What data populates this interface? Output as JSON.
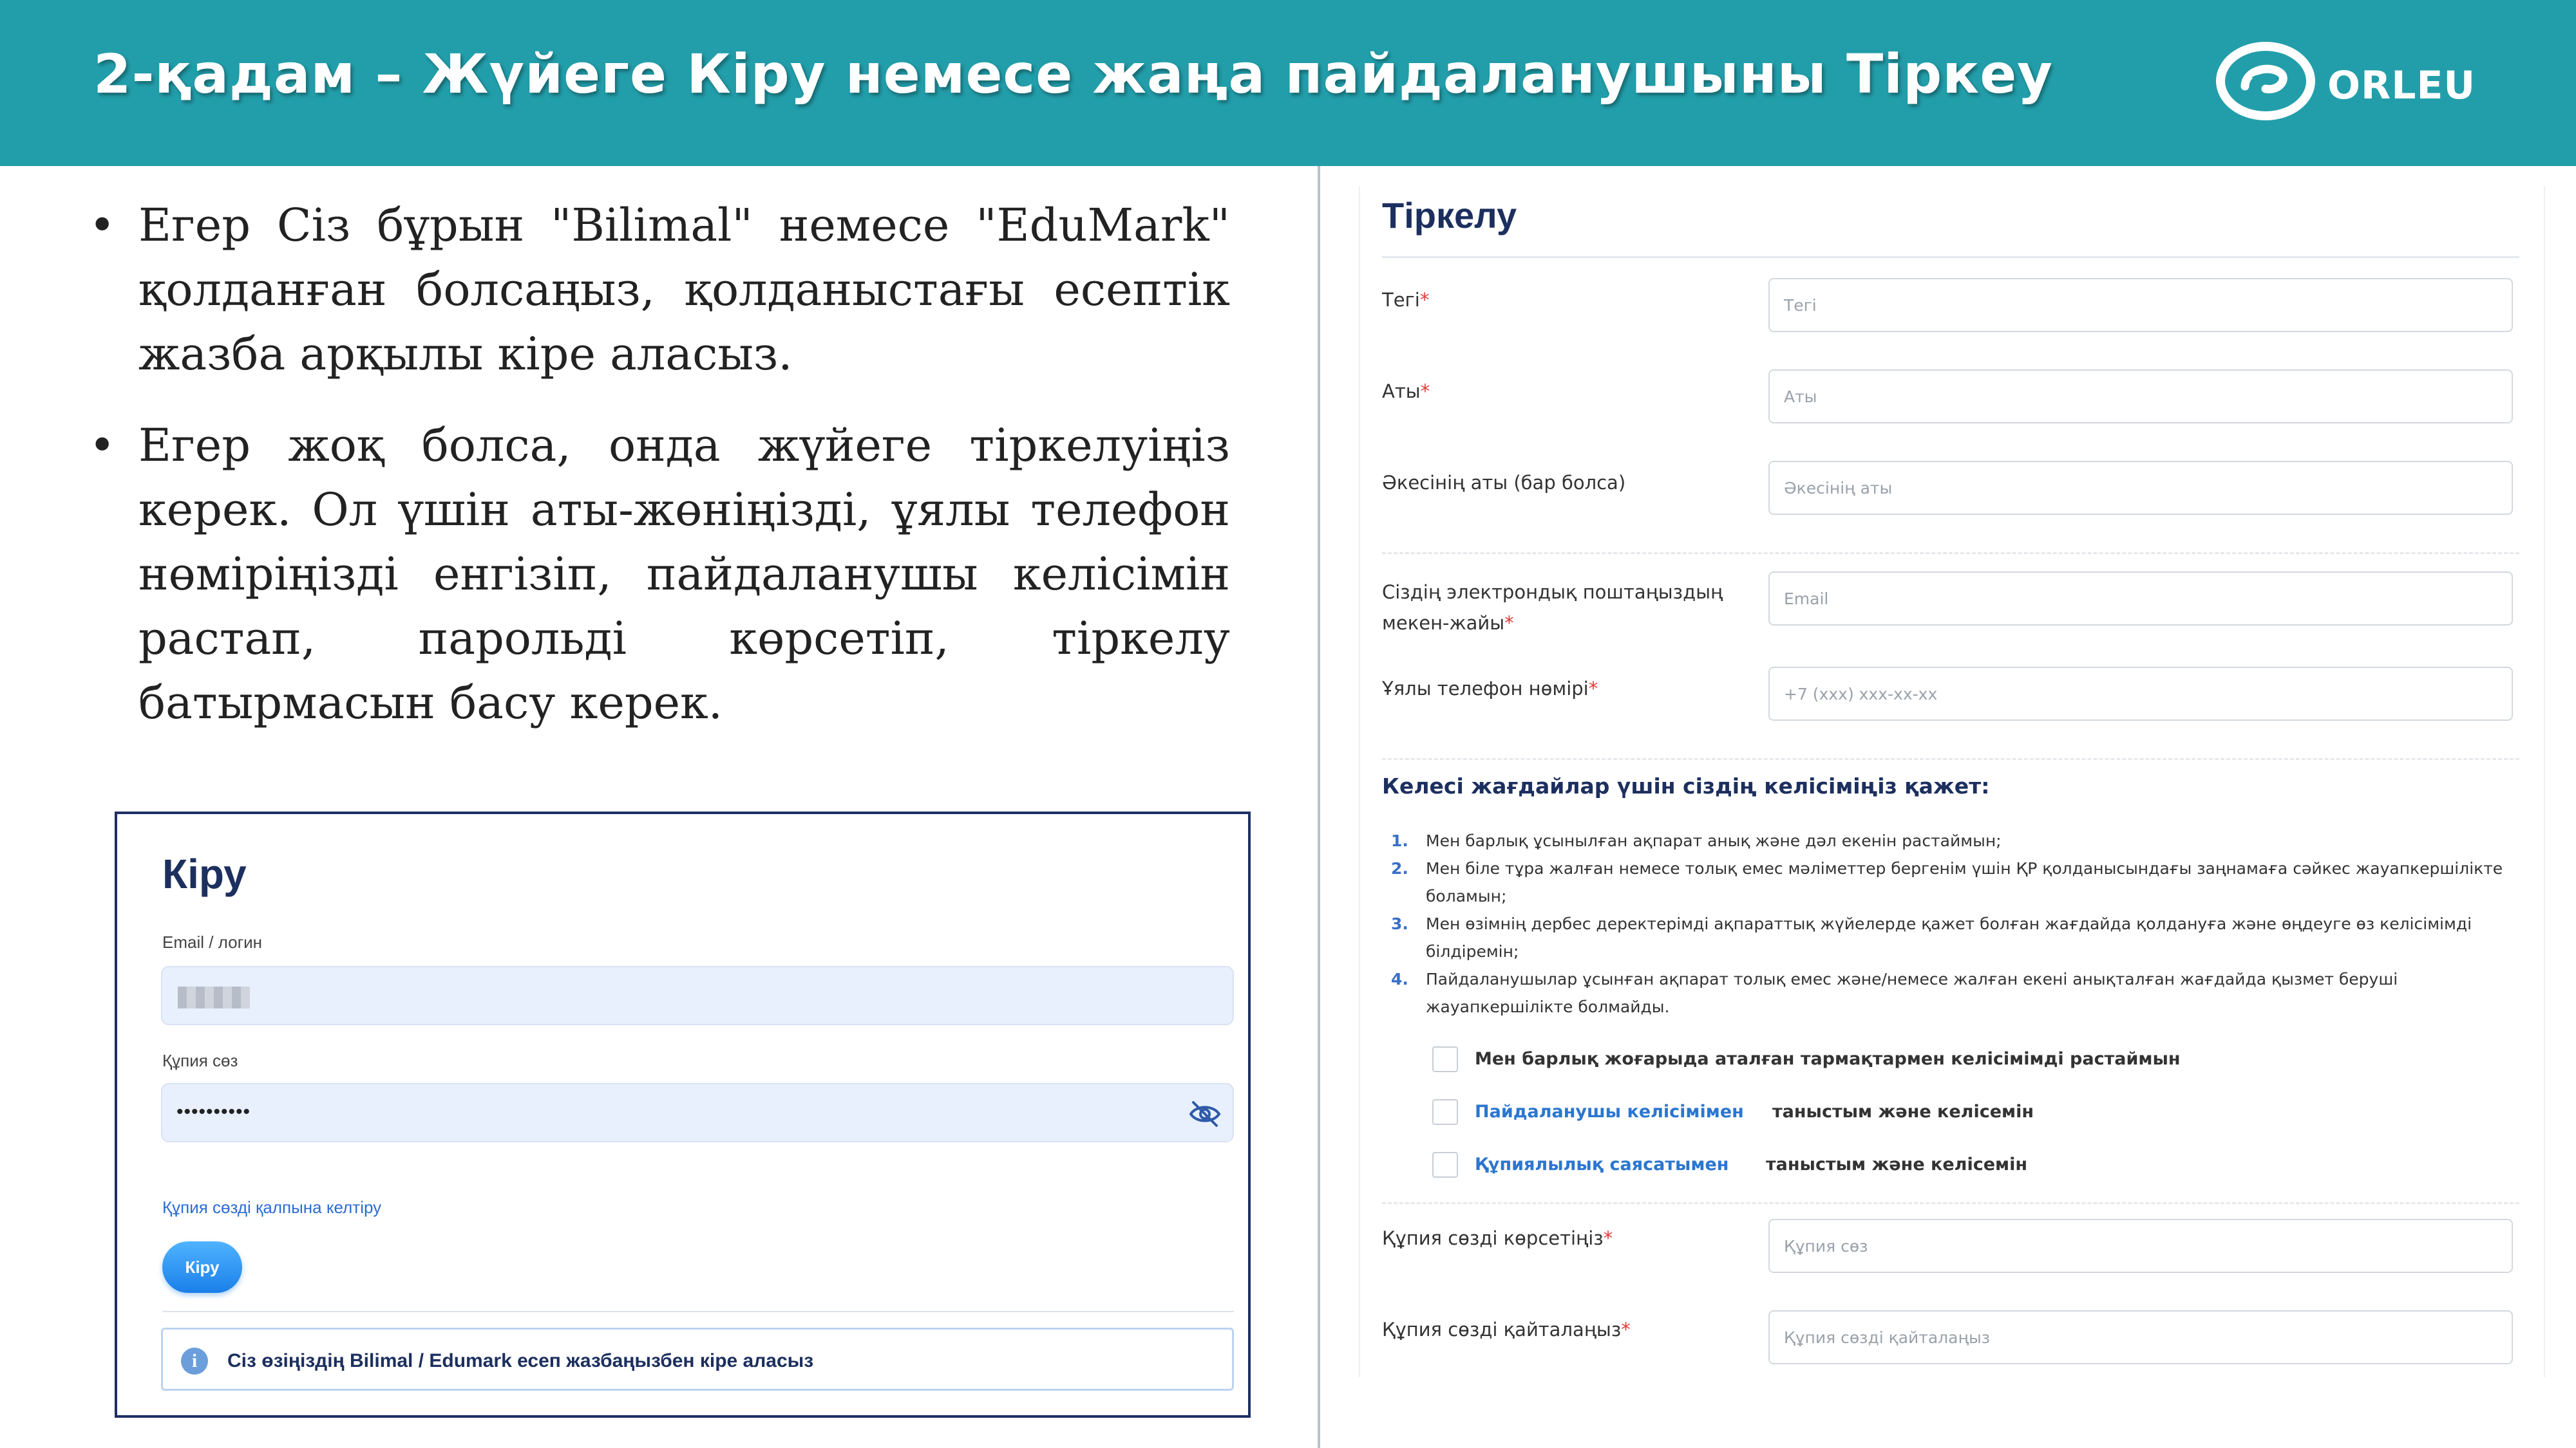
{
  "header": {
    "title": "2-қадам – Жүйеге Кіру немесе жаңа пайдаланушыны Тіркеу",
    "logo_text": "ORLEU",
    "background": "#229eaa"
  },
  "bullets": [
    "Егер Сіз бұрын \"Bilimal\" немесе \"EduMark\" қолданған болсаңыз, қолданыстағы есептік жазба арқылы кіре аласыз.",
    "Егер жоқ болса, онда жүйеге тіркелуіңіз керек. Ол үшін аты-жөніңізді, ұялы телефон нөміріңізді енгізіп, пайдаланушы келісімін растап, парольді көрсетіп, тіркелу батырмасын басу керек."
  ],
  "bullet_symbol": "•",
  "login": {
    "title": "Кіру",
    "email_label": "Email / логин",
    "password_label": "Құпия сөз",
    "password_value": "••••••••••",
    "reset_link": "Құпия сөзді қалпына келтіру",
    "submit": "Кіру",
    "info_icon": "i",
    "info": "Сіз өзіңіздің Bilimal / Edumark есеп жазбаңызбен кіре аласыз"
  },
  "register": {
    "title": "Тіркелу",
    "required_mark": "*",
    "fields": [
      {
        "label": "Тегі",
        "required": "*",
        "placeholder": "Тегі"
      },
      {
        "label": "Аты",
        "required": "*",
        "placeholder": "Аты"
      },
      {
        "label": "Әкесінің аты (бар болса)",
        "required": "",
        "placeholder": "Әкесінің аты"
      },
      {
        "label": "Сіздің электрондық поштаңыздың мекен-жайы",
        "required": "*",
        "placeholder": "Email"
      },
      {
        "label": "Ұялы телефон нөмірі",
        "required": "*",
        "placeholder": "+7 (xxx) xxx-xx-xx"
      },
      {
        "label": "Құпия сөзді көрсетіңіз",
        "required": "*",
        "placeholder": "Құпия сөз"
      },
      {
        "label": "Құпия сөзді қайталаңыз",
        "required": "*",
        "placeholder": "Құпия сөзді қайталаңыз"
      }
    ],
    "consent_title": "Келесі жағдайлар үшін сіздің келісіміңіз қажет:",
    "terms": [
      {
        "num": "1.",
        "text": "Мен барлық ұсынылған ақпарат анық және дәл екенін растаймын;"
      },
      {
        "num": "2.",
        "text": "Мен біле тұра жалған немесе толық емес мәліметтер бергенім үшін ҚР қолданысындағы заңнамаға сәйкес жауапкершілікте боламын;"
      },
      {
        "num": "3.",
        "text": "Мен өзімнің дербес деректерімді ақпараттық жүйелерде қажет болған жағдайда қолдануға және өңдеуге өз келісімімді білдіремін;"
      },
      {
        "num": "4.",
        "text": "Пайдаланушылар ұсынған ақпарат толық емес және/немесе жалған екені анықталған жағдайда қызмет беруші жауапкершілікте болмайды."
      }
    ],
    "checkboxes": {
      "all": "Мен барлық жоғарыда аталған тармақтармен келісімімді растаймын",
      "user_agreement_link": "Пайдаланушы келісімімен",
      "user_agreement_suffix": "таныстым және келісемін",
      "privacy_link": "Құпиялылық саясатымен",
      "privacy_suffix": "таныстым және келісемін"
    }
  },
  "colors": {
    "navy": "#1c2f5e",
    "link": "#2b76d0",
    "required": "#e23c3c",
    "login_border": "#1f2f63"
  }
}
